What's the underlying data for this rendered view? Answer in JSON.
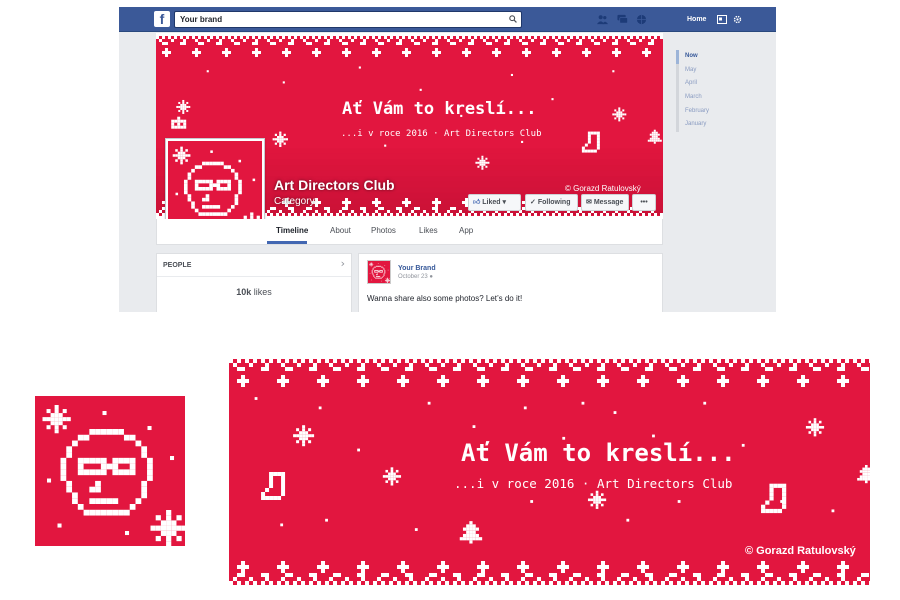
{
  "colors": {
    "brand_red": "#e2163f",
    "fb_blue": "#3b5998",
    "white": "#ffffff"
  },
  "topbar": {
    "logo": "f",
    "search_value": "Your brand",
    "search_icon": "search-icon",
    "home_label": "Home",
    "icons": [
      "friends-icon",
      "messages-icon",
      "globe-icon",
      "pages-icon",
      "settings-icon"
    ]
  },
  "cover": {
    "headline": "Ať Vám to kreslí...",
    "subline": "...i v roce 2016 · Art Directors Club",
    "credit": "© Gorazd Ratulovský"
  },
  "page": {
    "name": "Art Directors Club",
    "category": "Category",
    "buttons": {
      "liked": "Liked",
      "following": "Following",
      "message": "Message",
      "more": "•••"
    },
    "tabs": [
      {
        "label": "Timeline",
        "active": true
      },
      {
        "label": "About"
      },
      {
        "label": "Photos"
      },
      {
        "label": "Likes"
      },
      {
        "label": "App"
      }
    ]
  },
  "people": {
    "header": "PEOPLE",
    "likes_count": "10k",
    "likes_label": "likes"
  },
  "post": {
    "author": "Your Brand",
    "date": "October 23",
    "text": "Wanna share also some photos? Let’s do it!"
  },
  "timeline_years": [
    {
      "label": "Now",
      "active": true
    },
    {
      "label": "May"
    },
    {
      "label": "April"
    },
    {
      "label": "March"
    },
    {
      "label": "February"
    },
    {
      "label": "January"
    }
  ]
}
